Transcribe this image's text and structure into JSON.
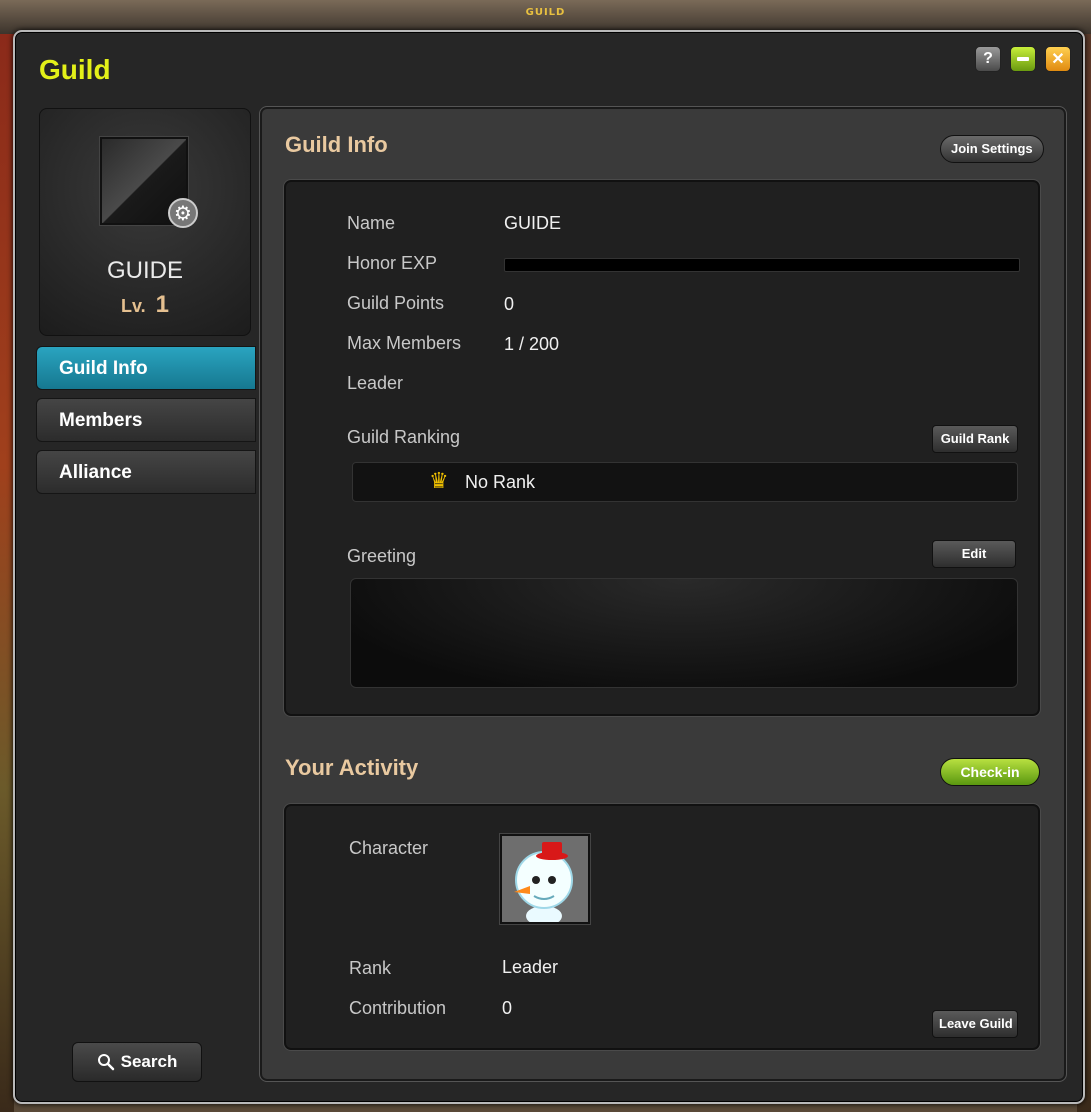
{
  "background": {
    "top_label": "GUILD"
  },
  "window": {
    "title": "Guild",
    "help_label": "?",
    "close_label": "✕"
  },
  "profile": {
    "name": "GUIDE",
    "level_prefix": "Lv.",
    "level": "1"
  },
  "nav": {
    "items": [
      {
        "label": "Guild Info",
        "active": true
      },
      {
        "label": "Members",
        "active": false
      },
      {
        "label": "Alliance",
        "active": false
      }
    ]
  },
  "search": {
    "label": "Search"
  },
  "guild_info": {
    "title": "Guild Info",
    "join_settings_label": "Join Settings",
    "fields": {
      "name_label": "Name",
      "name_value": "GUIDE",
      "honor_exp_label": "Honor EXP",
      "honor_exp_fraction": 0,
      "points_label": "Guild Points",
      "points_value": "0",
      "max_members_label": "Max Members",
      "max_members_value": "1 / 200",
      "leader_label": "Leader"
    },
    "ranking_label": "Guild Ranking",
    "guild_rank_button": "Guild Rank",
    "rank_value": "No Rank",
    "greeting_label": "Greeting",
    "edit_button": "Edit"
  },
  "activity": {
    "title": "Your Activity",
    "checkin_label": "Check-in",
    "character_label": "Character",
    "rank_label": "Rank",
    "rank_value": "Leader",
    "contribution_label": "Contribution",
    "contribution_value": "0",
    "leave_label": "Leave Guild"
  },
  "colors": {
    "title_yellow": "#e3f019",
    "section_title": "#e9c9a0",
    "active_tab": "#2aa4c0",
    "checkin_green": "#8cc828"
  }
}
